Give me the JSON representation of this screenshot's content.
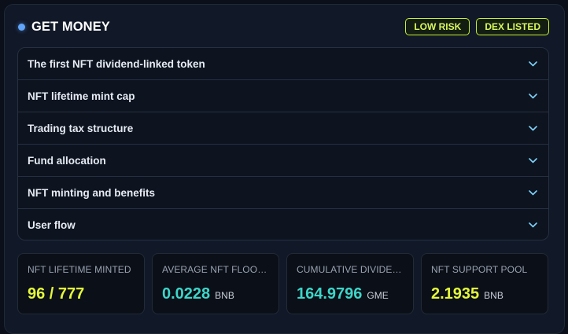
{
  "header": {
    "title": "GET MONEY",
    "badges": [
      "LOW RISK",
      "DEX LISTED"
    ]
  },
  "accordion": {
    "items": [
      "The first NFT dividend-linked token",
      "NFT lifetime mint cap",
      "Trading tax structure",
      "Fund allocation",
      "NFT minting and benefits",
      "User flow"
    ]
  },
  "stats": [
    {
      "label": "NFT LIFETIME MINTED",
      "value": "96 / 777",
      "unit": "",
      "color": "#e4f93a"
    },
    {
      "label": "AVERAGE NFT FLOOR PRICE",
      "value": "0.0228",
      "unit": "BNB",
      "color": "#3dd6c9"
    },
    {
      "label": "CUMULATIVE DIVIDENDS",
      "value": "164.9796",
      "unit": "GME",
      "color": "#3dd6c9"
    },
    {
      "label": "NFT SUPPORT POOL",
      "value": "2.1935",
      "unit": "BNB",
      "color": "#e4f93a"
    }
  ],
  "colors": {
    "accent_lime": "#d9f95a",
    "accent_teal": "#3dd6c9",
    "dot_blue": "#60a5fa",
    "chevron": "#7dd3fc"
  },
  "icons": {
    "header_dot": "status-dot-icon",
    "accordion_toggle": "chevron-down-icon"
  }
}
